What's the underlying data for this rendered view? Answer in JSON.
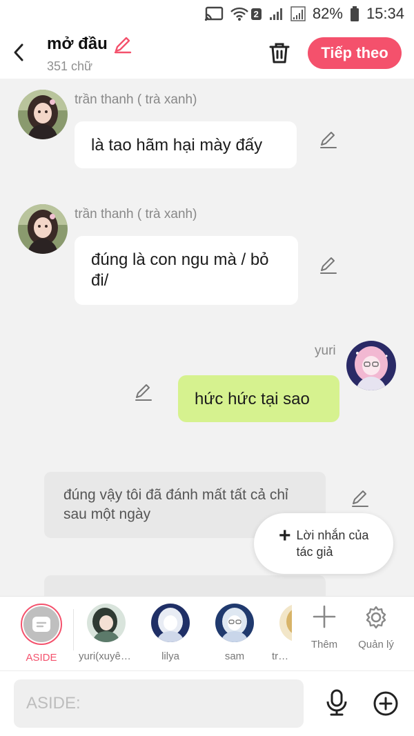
{
  "status_bar": {
    "sim": "2",
    "battery": "82%",
    "time": "15:34"
  },
  "header": {
    "title": "mở đầu",
    "word_count": "351 chữ",
    "next_label": "Tiếp theo"
  },
  "messages": [
    {
      "sender": "trần thanh ( trà xanh)",
      "text": "là tao hãm hại mày đấy"
    },
    {
      "sender": "trần thanh ( trà xanh)",
      "text": "đúng là con ngu mà / bỏ đi/"
    },
    {
      "sender": "yuri",
      "text": "hức hức tại sao"
    }
  ],
  "narrations": [
    {
      "text": "đúng vậy tôi đã đánh mất tất cả chỉ sau một ngày"
    }
  ],
  "fab": {
    "label": "Lời nhắn của tác giả"
  },
  "characters": [
    {
      "name": "ASIDE"
    },
    {
      "name": "yuri(xuyên..."
    },
    {
      "name": "lilya"
    },
    {
      "name": "sam"
    },
    {
      "name": "trươ"
    }
  ],
  "tools": {
    "more": "Thêm",
    "manage": "Quản lý"
  },
  "input": {
    "placeholder": "ASIDE:"
  },
  "colors": {
    "accent": "#f4516c",
    "bubble_self": "#d6f28f"
  }
}
